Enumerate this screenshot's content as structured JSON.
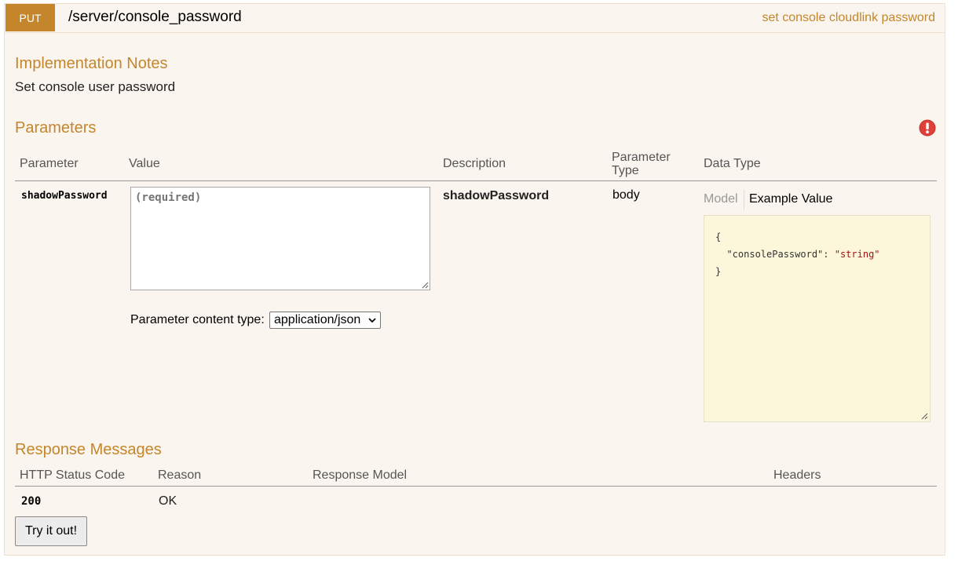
{
  "operation": {
    "method": "PUT",
    "path": "/server/console_password",
    "summary": "set console cloudlink password"
  },
  "implementation_notes": {
    "heading": "Implementation Notes",
    "text": "Set console user password"
  },
  "parameters": {
    "heading": "Parameters",
    "columns": [
      "Parameter",
      "Value",
      "Description",
      "Parameter Type",
      "Data Type"
    ],
    "rows": [
      {
        "name": "shadowPassword",
        "value_placeholder": "(required)",
        "value": "",
        "description": "shadowPassword",
        "param_type": "body",
        "content_type_label": "Parameter content type:",
        "content_type_selected": "application/json",
        "data_type_tabs": [
          "Model",
          "Example Value"
        ],
        "active_tab": "Example Value",
        "example": {
          "open": "{",
          "key": "\"consolePassword\"",
          "value": "\"string\"",
          "close": "}"
        }
      }
    ]
  },
  "responses": {
    "heading": "Response Messages",
    "columns": [
      "HTTP Status Code",
      "Reason",
      "Response Model",
      "Headers"
    ],
    "rows": [
      {
        "code": "200",
        "reason": "OK",
        "model": "",
        "headers": ""
      }
    ]
  },
  "actions": {
    "try_label": "Try it out!"
  },
  "icons": {
    "validation": "error-icon",
    "textarea_grip": "resize-grip-icon",
    "select_arrow": "chevron-down-icon"
  },
  "colors": {
    "method_bg": "#c5862b",
    "accent": "#c5862b",
    "panel_bg": "#faf5ee",
    "snippet_bg": "#fcf6db",
    "error": "#e0403a",
    "string": "#a31515"
  }
}
